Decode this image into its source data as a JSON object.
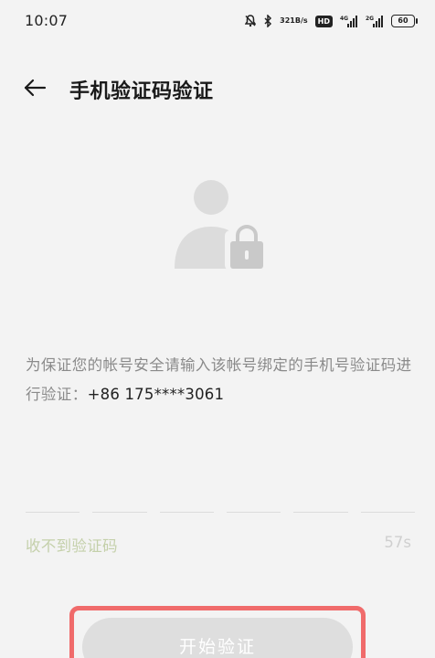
{
  "status_bar": {
    "time": "10:07",
    "net_speed_value": "321",
    "net_speed_unit": "B/s",
    "hd_badge": "HD",
    "battery_level": "60"
  },
  "header": {
    "title": "手机验证码验证"
  },
  "info": {
    "message": "为保证您的帐号安全请输入该帐号绑定的手机号验证码进行验证：",
    "phone": "+86 175****3061"
  },
  "code_input": {
    "slot_count": 6
  },
  "resend": {
    "label": "收不到验证码",
    "countdown": "57s"
  },
  "primary_button": {
    "label": "开始验证"
  },
  "colors": {
    "background": "#f3f3f3",
    "highlight": "#f06b6b",
    "resend_text": "#c4d0aa",
    "button_disabled": "#dedede"
  }
}
